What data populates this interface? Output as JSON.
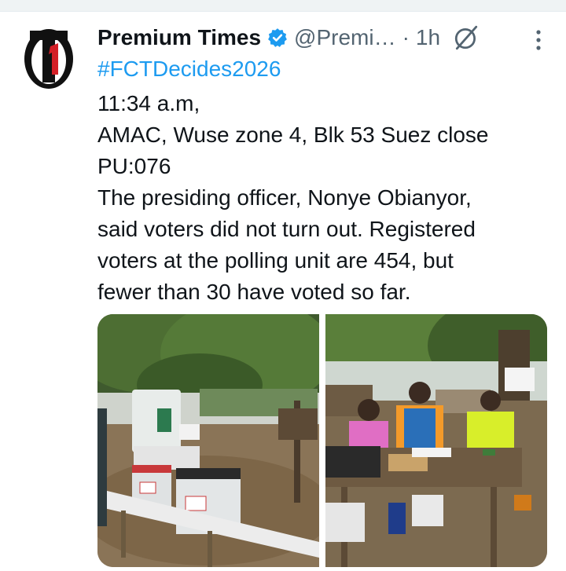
{
  "tweet": {
    "author_name": "Premium Times",
    "handle": "@Premi…",
    "separator": "·",
    "time": "1h",
    "hashtag": "#FCTDecides2026",
    "lines": [
      "11:34 a.m,",
      "AMAC, Wuse zone 4, Blk 53 Suez close",
      "PU:076",
      "The presiding officer, Nonye Obianyor,",
      "said voters did not turn out. Registered",
      "voters at the polling unit are 454, but",
      "fewer than 30 have voted so far."
    ]
  },
  "icons": {
    "avatar": "premium-times-logo",
    "verified": "verified-badge-icon",
    "grok": "grok-icon",
    "more": "more-options-icon"
  },
  "colors": {
    "text": "#0f1419",
    "secondary": "#536471",
    "link": "#1d9bf0"
  }
}
